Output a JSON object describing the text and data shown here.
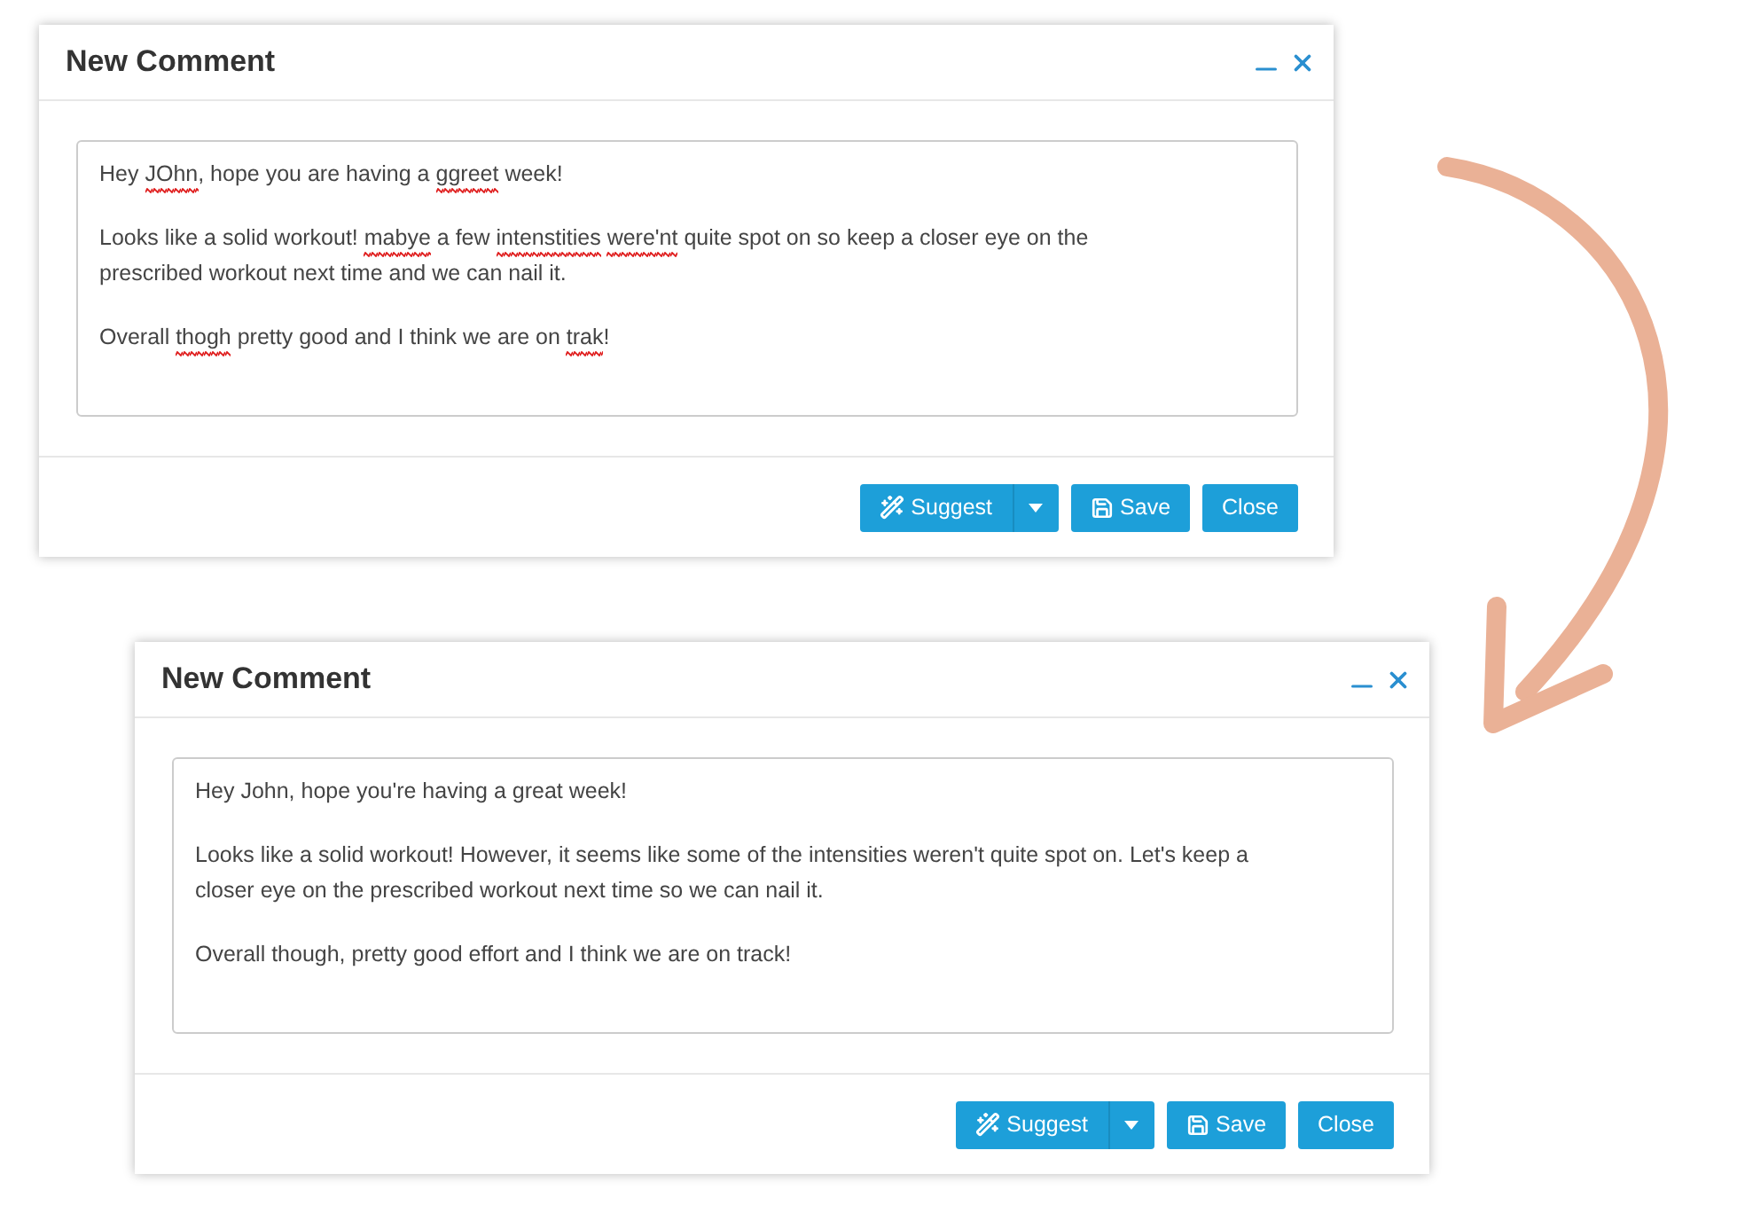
{
  "dialogs": [
    {
      "title": "New Comment",
      "comment": [
        {
          "lines": [
            [
              {
                "text": "Hey ",
                "misspelled": false
              },
              {
                "text": "JOhn",
                "misspelled": true
              },
              {
                "text": ", hope you are having a ",
                "misspelled": false
              },
              {
                "text": "ggreet",
                "misspelled": true
              },
              {
                "text": " week!",
                "misspelled": false
              }
            ]
          ]
        },
        {
          "lines": [
            [
              {
                "text": "Looks like a solid workout! ",
                "misspelled": false
              },
              {
                "text": "mabye",
                "misspelled": true
              },
              {
                "text": " a few ",
                "misspelled": false
              },
              {
                "text": "intenstities",
                "misspelled": true
              },
              {
                "text": " were'nt",
                "misspelled": true
              },
              {
                "text": " quite spot on so keep a closer eye on the",
                "misspelled": false
              }
            ],
            [
              {
                "text": "prescribed workout next time and we can nail it.",
                "misspelled": false
              }
            ]
          ]
        },
        {
          "lines": [
            [
              {
                "text": "Overall ",
                "misspelled": false
              },
              {
                "text": "thogh",
                "misspelled": true
              },
              {
                "text": " pretty good and I think we are on ",
                "misspelled": false
              },
              {
                "text": "trak",
                "misspelled": true
              },
              {
                "text": "!",
                "misspelled": false
              }
            ]
          ]
        }
      ],
      "buttons": [
        {
          "kind": "split",
          "label": "Suggest"
        },
        {
          "kind": "save",
          "label": "Save"
        },
        {
          "kind": "plain",
          "label": "Close"
        }
      ]
    },
    {
      "title": "New Comment",
      "comment": [
        {
          "lines": [
            [
              {
                "text": "Hey John, hope you're having a great week!",
                "misspelled": false
              }
            ]
          ]
        },
        {
          "lines": [
            [
              {
                "text": "Looks like a solid workout! However, it seems like some of the intensities weren't quite spot on. Let's keep a",
                "misspelled": false
              }
            ],
            [
              {
                "text": "closer eye on the prescribed workout next time so we can nail it.",
                "misspelled": false
              }
            ]
          ]
        },
        {
          "lines": [
            [
              {
                "text": "Overall though, pretty good effort and I think we are on track!",
                "misspelled": false
              }
            ]
          ]
        }
      ],
      "buttons": [
        {
          "kind": "split",
          "label": "Suggest"
        },
        {
          "kind": "save",
          "label": "Save"
        },
        {
          "kind": "plain",
          "label": "Close"
        }
      ]
    }
  ]
}
